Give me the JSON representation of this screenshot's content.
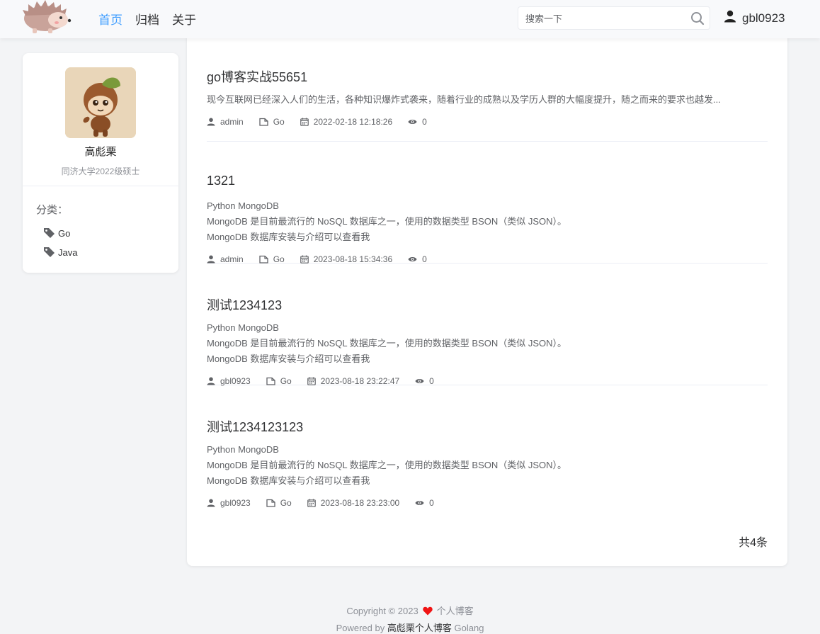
{
  "header": {
    "nav": [
      {
        "label": "首页",
        "active": true
      },
      {
        "label": "归档",
        "active": false
      },
      {
        "label": "关于",
        "active": false
      }
    ],
    "search_placeholder": "搜索一下",
    "username": "gbl0923"
  },
  "profile": {
    "name": "高彪栗",
    "description": "同济大学2022级硕士",
    "categories_title": "分类：",
    "categories": [
      "Go",
      "Java"
    ]
  },
  "articles": [
    {
      "title": "go博客实战55651",
      "summary": [
        "现今互联网已经深入人们的生活，各种知识爆炸式袭来，随着行业的成熟以及学历人群的大幅度提升，随之而来的要求也越发..."
      ],
      "author": "admin",
      "category": "Go",
      "date": "2022-02-18 12:18:26",
      "views": "0"
    },
    {
      "title": "1321",
      "summary": [
        "Python MongoDB",
        "MongoDB 是目前最流行的 NoSQL 数据库之一，使用的数据类型 BSON（类似 JSON）。",
        "MongoDB 数据库安装与介绍可以查看我"
      ],
      "author": "admin",
      "category": "Go",
      "date": "2023-08-18 15:34:36",
      "views": "0"
    },
    {
      "title": "测试1234123",
      "summary": [
        "Python MongoDB",
        "MongoDB 是目前最流行的 NoSQL 数据库之一，使用的数据类型 BSON（类似 JSON）。",
        "MongoDB 数据库安装与介绍可以查看我"
      ],
      "author": "gbl0923",
      "category": "Go",
      "date": "2023-08-18 23:22:47",
      "views": "0"
    },
    {
      "title": "测试1234123123",
      "summary": [
        "Python MongoDB",
        "MongoDB 是目前最流行的 NoSQL 数据库之一，使用的数据类型 BSON（类似 JSON）。",
        "MongoDB 数据库安装与介绍可以查看我"
      ],
      "author": "gbl0923",
      "category": "Go",
      "date": "2023-08-18 23:23:00",
      "views": "0"
    }
  ],
  "pagination": {
    "total": "共4条"
  },
  "footer": {
    "copyright": "Copyright © 2023",
    "site_name": "个人博客",
    "powered_prefix": "Powered by",
    "powered_blog": "高彪栗个人博客",
    "powered_suffix": "Golang"
  },
  "colors": {
    "accent": "#409eff",
    "heart": "#f01414",
    "background": "#f3f4f6"
  },
  "icons": [
    "hedgehog-logo",
    "search-icon",
    "user-icon",
    "tag-icon",
    "folder-icon",
    "calendar-icon",
    "eye-icon",
    "heart-icon"
  ]
}
